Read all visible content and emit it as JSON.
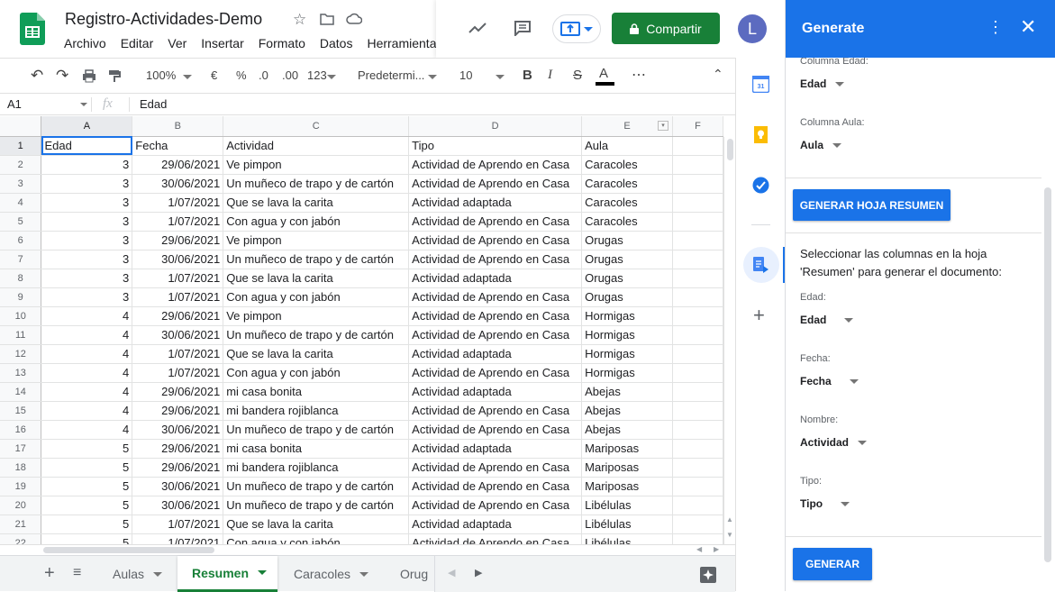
{
  "doc": {
    "title": "Registro-Actividades-Demo",
    "menu": [
      "Archivo",
      "Editar",
      "Ver",
      "Insertar",
      "Formato",
      "Datos",
      "Herramientas"
    ],
    "share_label": "Compartir",
    "avatar_letter": "L"
  },
  "toolbar": {
    "zoom": "100%",
    "currency": "€",
    "percent": "%",
    "dec_less": ".0",
    "dec_more": ".00",
    "format_more": "123",
    "font": "Predetermi...",
    "font_size": "10",
    "bold": "B",
    "italic": "I",
    "strike": "S",
    "text_color": "A",
    "more": "⋯"
  },
  "formula_bar": {
    "cell_ref": "A1",
    "fx": "fx",
    "content": "Edad"
  },
  "grid": {
    "columns": [
      "A",
      "B",
      "C",
      "D",
      "E",
      "F"
    ],
    "rows": [
      {
        "n": "1",
        "a": "Edad",
        "b": "Fecha",
        "c": "Actividad",
        "d": "Tipo",
        "e": "Aula"
      },
      {
        "n": "2",
        "a": "3",
        "b": "29/06/2021",
        "c": "Ve pimpon",
        "d": "Actividad de Aprendo en Casa",
        "e": "Caracoles"
      },
      {
        "n": "3",
        "a": "3",
        "b": "30/06/2021",
        "c": "Un muñeco de trapo y de cartón",
        "d": "Actividad de Aprendo en Casa",
        "e": "Caracoles"
      },
      {
        "n": "4",
        "a": "3",
        "b": "1/07/2021",
        "c": "Que se lava la carita",
        "d": "Actividad adaptada",
        "e": "Caracoles"
      },
      {
        "n": "5",
        "a": "3",
        "b": "1/07/2021",
        "c": "Con agua y con jabón",
        "d": "Actividad de Aprendo en Casa",
        "e": "Caracoles"
      },
      {
        "n": "6",
        "a": "3",
        "b": "29/06/2021",
        "c": "Ve pimpon",
        "d": "Actividad de Aprendo en Casa",
        "e": "Orugas"
      },
      {
        "n": "7",
        "a": "3",
        "b": "30/06/2021",
        "c": "Un muñeco de trapo y de cartón",
        "d": "Actividad de Aprendo en Casa",
        "e": "Orugas"
      },
      {
        "n": "8",
        "a": "3",
        "b": "1/07/2021",
        "c": "Que se lava la carita",
        "d": "Actividad adaptada",
        "e": "Orugas"
      },
      {
        "n": "9",
        "a": "3",
        "b": "1/07/2021",
        "c": "Con agua y con jabón",
        "d": "Actividad de Aprendo en Casa",
        "e": "Orugas"
      },
      {
        "n": "10",
        "a": "4",
        "b": "29/06/2021",
        "c": "Ve pimpon",
        "d": "Actividad de Aprendo en Casa",
        "e": "Hormigas"
      },
      {
        "n": "11",
        "a": "4",
        "b": "30/06/2021",
        "c": "Un muñeco de trapo y de cartón",
        "d": "Actividad de Aprendo en Casa",
        "e": "Hormigas"
      },
      {
        "n": "12",
        "a": "4",
        "b": "1/07/2021",
        "c": "Que se lava la carita",
        "d": "Actividad adaptada",
        "e": "Hormigas"
      },
      {
        "n": "13",
        "a": "4",
        "b": "1/07/2021",
        "c": "Con agua y con jabón",
        "d": "Actividad de Aprendo en Casa",
        "e": "Hormigas"
      },
      {
        "n": "14",
        "a": "4",
        "b": "29/06/2021",
        "c": "mi casa bonita",
        "d": "Actividad adaptada",
        "e": "Abejas"
      },
      {
        "n": "15",
        "a": "4",
        "b": "29/06/2021",
        "c": "mi bandera rojiblanca",
        "d": "Actividad de Aprendo en Casa",
        "e": "Abejas"
      },
      {
        "n": "16",
        "a": "4",
        "b": "30/06/2021",
        "c": "Un muñeco de trapo y de cartón",
        "d": "Actividad de Aprendo en Casa",
        "e": "Abejas"
      },
      {
        "n": "17",
        "a": "5",
        "b": "29/06/2021",
        "c": "mi casa bonita",
        "d": "Actividad adaptada",
        "e": "Mariposas"
      },
      {
        "n": "18",
        "a": "5",
        "b": "29/06/2021",
        "c": "mi bandera rojiblanca",
        "d": "Actividad de Aprendo en Casa",
        "e": "Mariposas"
      },
      {
        "n": "19",
        "a": "5",
        "b": "30/06/2021",
        "c": "Un muñeco de trapo y de cartón",
        "d": "Actividad de Aprendo en Casa",
        "e": "Mariposas"
      },
      {
        "n": "20",
        "a": "5",
        "b": "30/06/2021",
        "c": "Un muñeco de trapo y de cartón",
        "d": "Actividad de Aprendo en Casa",
        "e": "Libélulas"
      },
      {
        "n": "21",
        "a": "5",
        "b": "1/07/2021",
        "c": "Que se lava la carita",
        "d": "Actividad adaptada",
        "e": "Libélulas"
      },
      {
        "n": "22",
        "a": "5",
        "b": "1/07/2021",
        "c": "Con agua y con jabón",
        "d": "Actividad de Aprendo en Casa",
        "e": "Libélulas"
      }
    ]
  },
  "sheets": {
    "tabs": [
      "Aulas",
      "Resumen",
      "Caracoles",
      "Orug"
    ],
    "active": "Resumen"
  },
  "panel": {
    "title": "Generate",
    "col_edad_label": "Columna Edad:",
    "col_edad_value": "Edad",
    "col_aula_label": "Columna Aula:",
    "col_aula_value": "Aula",
    "summary_button": "GENERAR HOJA RESUMEN",
    "instructions": "Seleccionar las columnas  en la hoja 'Resumen' para generar el documento:",
    "fields": [
      {
        "label": "Edad:",
        "value": "Edad"
      },
      {
        "label": "Fecha:",
        "value": "Fecha"
      },
      {
        "label": "Nombre:",
        "value": "Actividad"
      },
      {
        "label": "Tipo:",
        "value": "Tipo"
      }
    ],
    "generate_button": "GENERAR"
  },
  "colors": {
    "primary": "#1a73e8",
    "share": "#188038",
    "active_tab": "#188038"
  }
}
